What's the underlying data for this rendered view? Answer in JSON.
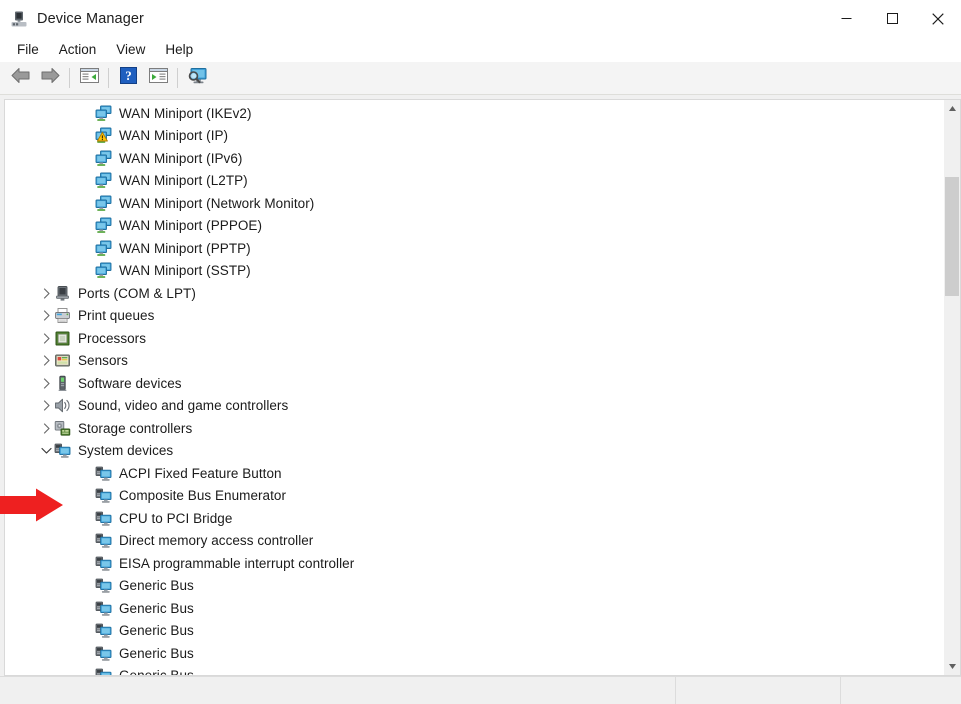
{
  "window": {
    "title": "Device Manager",
    "icon": "device-manager-icon",
    "caption": {
      "minimize": "minimize-icon",
      "maximize": "maximize-icon",
      "close": "close-icon"
    }
  },
  "menubar": {
    "items": [
      {
        "label": "File"
      },
      {
        "label": "Action"
      },
      {
        "label": "View"
      },
      {
        "label": "Help"
      }
    ]
  },
  "toolbar": {
    "buttons": [
      {
        "name": "back-arrow-icon",
        "title": "Back"
      },
      {
        "name": "forward-arrow-icon",
        "title": "Forward"
      },
      {
        "name": "show-hide-console-tree-icon",
        "title": "Show/hide console tree"
      },
      {
        "name": "help-icon",
        "title": "Help"
      },
      {
        "name": "properties-icon",
        "title": "Properties"
      },
      {
        "name": "scan-for-hardware-changes-icon",
        "title": "Scan for hardware changes"
      }
    ]
  },
  "tree": {
    "rows": [
      {
        "label": "WAN Miniport (IKEv2)",
        "level": 2,
        "icon": "network-adapter-icon",
        "chevron": "none"
      },
      {
        "label": "WAN Miniport (IP)",
        "level": 2,
        "icon": "network-adapter-warning-icon",
        "chevron": "none"
      },
      {
        "label": "WAN Miniport (IPv6)",
        "level": 2,
        "icon": "network-adapter-icon",
        "chevron": "none"
      },
      {
        "label": "WAN Miniport (L2TP)",
        "level": 2,
        "icon": "network-adapter-icon",
        "chevron": "none"
      },
      {
        "label": "WAN Miniport (Network Monitor)",
        "level": 2,
        "icon": "network-adapter-icon",
        "chevron": "none"
      },
      {
        "label": "WAN Miniport (PPPOE)",
        "level": 2,
        "icon": "network-adapter-icon",
        "chevron": "none"
      },
      {
        "label": "WAN Miniport (PPTP)",
        "level": 2,
        "icon": "network-adapter-icon",
        "chevron": "none"
      },
      {
        "label": "WAN Miniport (SSTP)",
        "level": 2,
        "icon": "network-adapter-icon",
        "chevron": "none"
      },
      {
        "label": "Ports (COM & LPT)",
        "level": 1,
        "icon": "ports-icon",
        "chevron": "collapsed"
      },
      {
        "label": "Print queues",
        "level": 1,
        "icon": "printer-icon",
        "chevron": "collapsed"
      },
      {
        "label": "Processors",
        "level": 1,
        "icon": "processor-icon",
        "chevron": "collapsed"
      },
      {
        "label": "Sensors",
        "level": 1,
        "icon": "sensor-icon",
        "chevron": "collapsed"
      },
      {
        "label": "Software devices",
        "level": 1,
        "icon": "software-device-icon",
        "chevron": "collapsed"
      },
      {
        "label": "Sound, video and game controllers",
        "level": 1,
        "icon": "speaker-icon",
        "chevron": "collapsed"
      },
      {
        "label": "Storage controllers",
        "level": 1,
        "icon": "storage-controller-icon",
        "chevron": "collapsed"
      },
      {
        "label": "System devices",
        "level": 1,
        "icon": "system-device-icon",
        "chevron": "expanded"
      },
      {
        "label": "ACPI Fixed Feature Button",
        "level": 2,
        "icon": "system-device-icon",
        "chevron": "none"
      },
      {
        "label": "Composite Bus Enumerator",
        "level": 2,
        "icon": "system-device-icon",
        "chevron": "none"
      },
      {
        "label": "CPU to PCI Bridge",
        "level": 2,
        "icon": "system-device-icon",
        "chevron": "none"
      },
      {
        "label": "Direct memory access controller",
        "level": 2,
        "icon": "system-device-icon",
        "chevron": "none"
      },
      {
        "label": "EISA programmable interrupt controller",
        "level": 2,
        "icon": "system-device-icon",
        "chevron": "none"
      },
      {
        "label": "Generic Bus",
        "level": 2,
        "icon": "system-device-icon",
        "chevron": "none"
      },
      {
        "label": "Generic Bus",
        "level": 2,
        "icon": "system-device-icon",
        "chevron": "none"
      },
      {
        "label": "Generic Bus",
        "level": 2,
        "icon": "system-device-icon",
        "chevron": "none"
      },
      {
        "label": "Generic Bus",
        "level": 2,
        "icon": "system-device-icon",
        "chevron": "none"
      },
      {
        "label": "Generic Bus",
        "level": 2,
        "icon": "system-device-icon",
        "chevron": "none"
      }
    ]
  },
  "scrollbar": {
    "vertical": {
      "thumb_top_pct": 11,
      "thumb_height_pct": 22
    }
  },
  "statusbar": {
    "main": "",
    "section2": "",
    "section3": ""
  },
  "annotation": {
    "arrow": {
      "color": "#ee2020",
      "points_to": "Sound, video and game controllers"
    }
  }
}
